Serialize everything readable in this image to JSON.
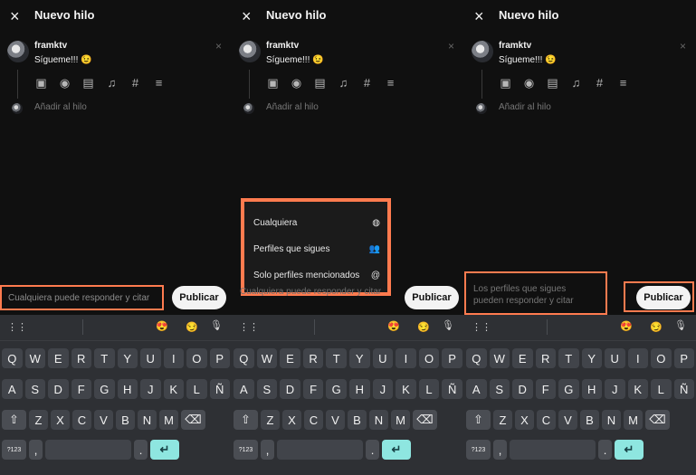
{
  "screens": [
    {
      "title": "Nuevo hilo",
      "user": "framktv",
      "message": "Sígueme!!! 😉",
      "add_thread": "Añadir al hilo",
      "reply_option": "Cualquiera puede responder y citar",
      "publish": "Publicar"
    },
    {
      "title": "Nuevo hilo",
      "user": "framktv",
      "message": "Sígueme!!! 😉",
      "add_thread": "Añadir al hilo",
      "reply_option": "Cualquiera puede responder y citar",
      "publish": "Publicar",
      "menu": [
        "Cualquiera",
        "Perfiles que sigues",
        "Solo perfiles mencionados"
      ]
    },
    {
      "title": "Nuevo hilo",
      "user": "framktv",
      "message": "Sígueme!!! 😉",
      "add_thread": "Añadir al hilo",
      "reply_option": "Los perfiles que sigues pueden responder y citar",
      "publish": "Publicar"
    }
  ],
  "icons": {
    "close": "×",
    "small_close": "×",
    "gallery": "▣",
    "camera": "◉",
    "gif": "▤",
    "mic": "♫",
    "hash": "#",
    "align": "≡",
    "globe": "◍",
    "following": "👥",
    "mention": "@",
    "grid": "⋮⋮",
    "heart_eyes": "😍",
    "smirk": "😏",
    "mic_key": "🎙",
    "shift": "⇧",
    "backspace": "⌫",
    "enter": "↵"
  },
  "keyboard": {
    "row1": [
      "Q",
      "W",
      "E",
      "R",
      "T",
      "Y",
      "U",
      "I",
      "O",
      "P"
    ],
    "row2": [
      "A",
      "S",
      "D",
      "F",
      "G",
      "H",
      "J",
      "K",
      "L",
      "Ñ"
    ],
    "row3": [
      "Z",
      "X",
      "C",
      "V",
      "B",
      "N",
      "M"
    ],
    "special": {
      "numbers": "?123",
      "comma": ",",
      "dot": ".",
      "space": ""
    }
  },
  "colors": {
    "accent": "#ff7b4f",
    "enter": "#8ee6e0"
  }
}
